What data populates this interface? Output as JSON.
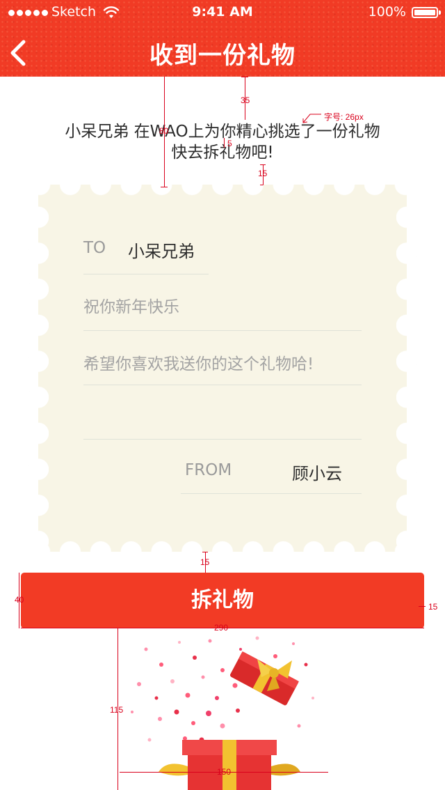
{
  "status_bar": {
    "carrier": "Sketch",
    "time": "9:41 AM",
    "battery": "100%"
  },
  "header": {
    "title": "收到一份礼物",
    "bg_color": "#f13b25"
  },
  "message": {
    "line1": "小呆兄弟 在WAO上为你精心挑选了一份礼物",
    "line2": "快去拆礼物吧!"
  },
  "card": {
    "to_label": "TO",
    "to_name": "小呆兄弟",
    "wish_line1": "祝你新年快乐",
    "wish_line2": "希望你喜欢我送你的这个礼物哈!",
    "from_label": "FROM",
    "from_name": "顾小云",
    "bg_color": "#f8f5e6"
  },
  "button": {
    "label": "拆礼物",
    "color": "#f23b25"
  },
  "annotations": {
    "header_to_text": "35",
    "text_block": "80",
    "line_gap": "5",
    "font_size_note": "字号: 26px",
    "text_to_card": "15",
    "card_to_button": "15",
    "button_height": "40",
    "button_side": "15",
    "button_width": "290",
    "gift_height": "115",
    "gift_width": "150"
  }
}
